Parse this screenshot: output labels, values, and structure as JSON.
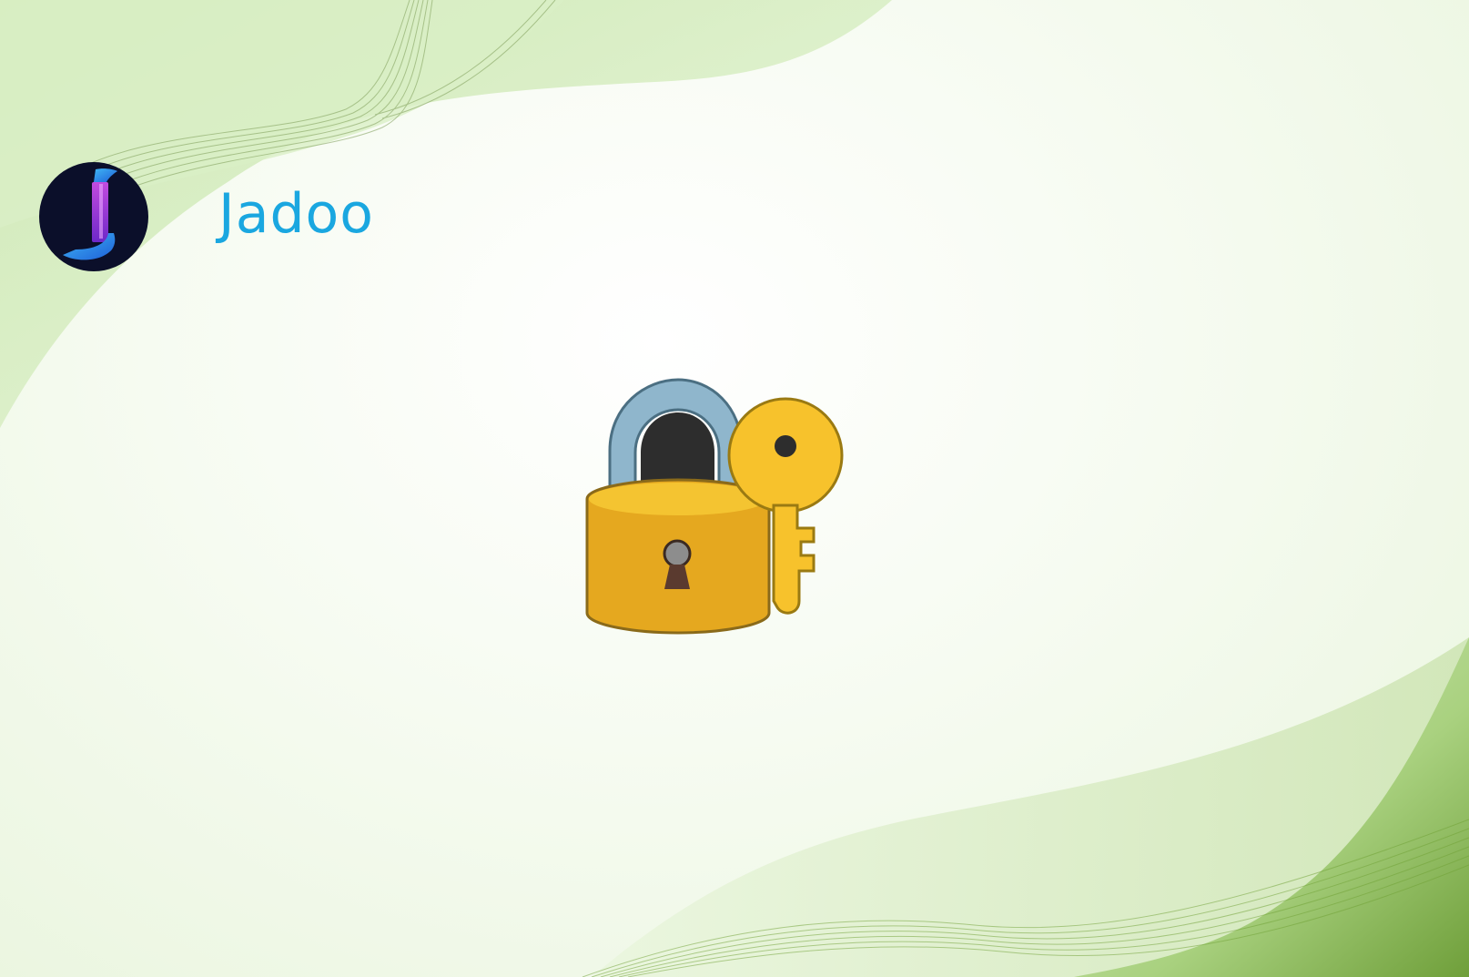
{
  "app": {
    "brand_name": "Jadoo",
    "brand_color": "#1aa7e0"
  },
  "logo": {
    "icon": "jadoo-logo-icon",
    "background_color": "#0b0f2a"
  },
  "center_illustration": {
    "icon": "locked-with-key-icon",
    "lock_color": "#e5a81f",
    "key_color": "#f7c22c"
  },
  "theme": {
    "background": "#f6fbf1",
    "accent_green": "#7fb04a"
  }
}
